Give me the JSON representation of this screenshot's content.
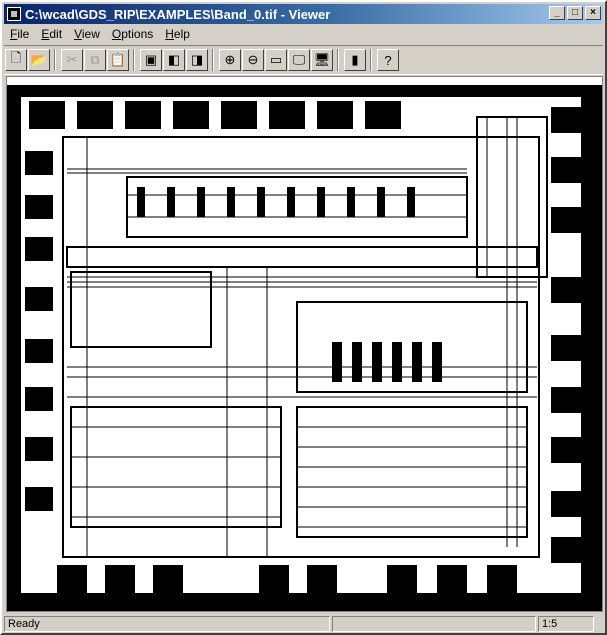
{
  "window": {
    "title": "C:\\wcad\\GDS_RIP\\EXAMPLES\\Band_0.tif - Viewer",
    "controls": {
      "minimize": "_",
      "maximize": "□",
      "close": "×"
    }
  },
  "menu": {
    "items": [
      "File",
      "Edit",
      "View",
      "Options",
      "Help"
    ],
    "mnemonics": [
      "F",
      "E",
      "V",
      "O",
      "H"
    ]
  },
  "toolbar": {
    "buttons": [
      {
        "icon": "new-document-icon",
        "glyph": "🗋",
        "enabled": true
      },
      {
        "icon": "open-folder-icon",
        "glyph": "📂",
        "enabled": true
      },
      {
        "icon": "cut-icon",
        "glyph": "✂",
        "enabled": false
      },
      {
        "icon": "copy-icon",
        "glyph": "⧉",
        "enabled": false
      },
      {
        "icon": "paste-icon",
        "glyph": "📋",
        "enabled": false
      },
      {
        "icon": "layer-view-icon",
        "glyph": "▣",
        "enabled": true
      },
      {
        "icon": "layer-stack-icon",
        "glyph": "◧",
        "enabled": true
      },
      {
        "icon": "layer-color-icon",
        "glyph": "◨",
        "enabled": true
      },
      {
        "icon": "zoom-in-icon",
        "glyph": "⊕",
        "enabled": true
      },
      {
        "icon": "zoom-out-icon",
        "glyph": "⊖",
        "enabled": true
      },
      {
        "icon": "zoom-1-1-icon",
        "glyph": "▭",
        "enabled": true
      },
      {
        "icon": "monitor-fit-icon",
        "glyph": "🖵",
        "enabled": true
      },
      {
        "icon": "monitor-color-icon",
        "glyph": "🖥",
        "enabled": true
      },
      {
        "icon": "ruler-icon",
        "glyph": "▮",
        "enabled": true
      },
      {
        "icon": "help-icon",
        "glyph": "?",
        "enabled": true
      }
    ]
  },
  "status": {
    "text": "Ready",
    "zoom": "1:5"
  },
  "colors": {
    "title_start": "#0a246a",
    "title_end": "#a6caf0",
    "face": "#d4d0c8",
    "ink": "#000000"
  }
}
